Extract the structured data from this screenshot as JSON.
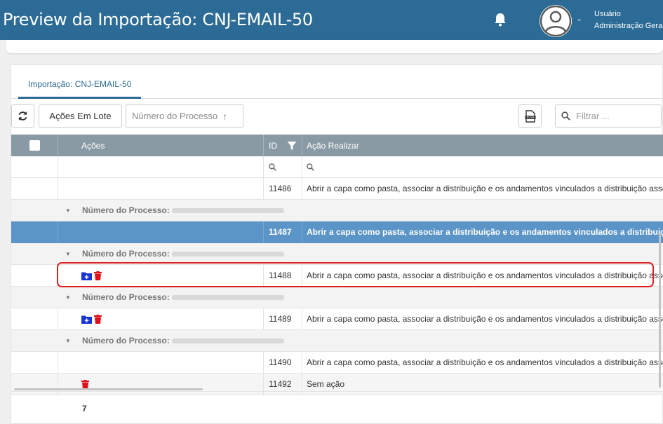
{
  "header": {
    "title": "Preview da Importação: CNJ-EMAIL-50",
    "user_name": "Usuário",
    "user_role": "Administração Geral",
    "icons": {
      "bell": "bell-icon",
      "avatar": "user-avatar-icon"
    }
  },
  "tabs": [
    {
      "label": "Importação: CNJ-EMAIL-50",
      "active": true
    }
  ],
  "toolbar": {
    "refresh_icon": "refresh-icon",
    "lote_label": "Ações Em Lote",
    "sort_label": "Número do Processo",
    "sort_arrow": "↑",
    "xlsx_icon": "xlsx-export-icon",
    "filter_placeholder": "Filtrar ..."
  },
  "grid": {
    "columns": {
      "acoes": "Ações",
      "id": "ID",
      "acao_realizar": "Ação Realizar"
    },
    "group_label": "Número do Processo:",
    "rows": [
      {
        "id": "11486",
        "acao": "Abrir a capa como pasta, associar a distribuição e os andamentos vinculados a distribuição associa"
      },
      {
        "id": "11487",
        "acao": "Abrir a capa como pasta, associar a distribuição e os andamentos vinculados a distribuição associa"
      },
      {
        "id": "11488",
        "acao": "Abrir a capa como pasta, associar a distribuição e os andamentos vinculados a distribuição associa"
      },
      {
        "id": "11489",
        "acao": "Abrir a capa como pasta, associar a distribuição e os andamentos vinculados a distribuição associa"
      },
      {
        "id": "11490",
        "acao": "Abrir a capa como pasta, associar a distribuição e os andamentos vinculados a distribuição associa"
      },
      {
        "id": "11492",
        "acao": "Sem ação"
      }
    ],
    "total": "7"
  },
  "colors": {
    "header_bg": "#2b6b95",
    "grid_header_bg": "#8a9aa5",
    "selected_row": "#5b94c6",
    "highlight": "#e02020",
    "delete_icon": "#e0101a",
    "folder_icon": "#1a35d6"
  }
}
